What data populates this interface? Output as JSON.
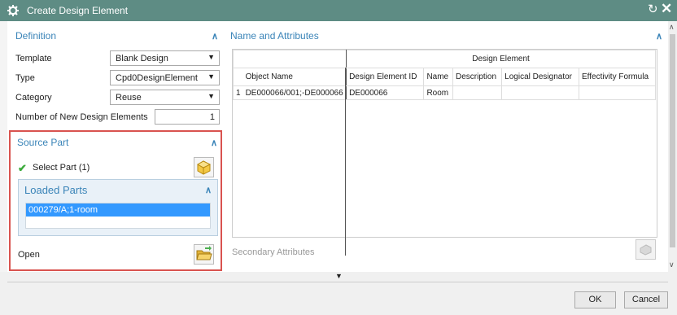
{
  "window": {
    "title": "Create Design Element",
    "reset_icon": "reset-icon",
    "close_icon": "close-icon",
    "gear_icon": "gear-icon"
  },
  "definition": {
    "header": "Definition",
    "fields": [
      {
        "label": "Template",
        "value": "Blank Design"
      },
      {
        "label": "Type",
        "value": "Cpd0DesignElement"
      },
      {
        "label": "Category",
        "value": "Reuse"
      }
    ],
    "number_label": "Number of New Design Elements",
    "number_value": "1"
  },
  "source_part": {
    "header": "Source Part",
    "select_label": "Select Part (1)",
    "loaded_parts": {
      "header": "Loaded Parts",
      "items": [
        "000279/A;1-room"
      ]
    },
    "open_label": "Open"
  },
  "name_attributes": {
    "header": "Name and Attributes",
    "group_header": "Design Element",
    "columns": [
      "Object Name",
      "Design Element ID",
      "Name",
      "Description",
      "Logical Designator",
      "Effectivity Formula"
    ],
    "rows": [
      {
        "index": "1",
        "object_name": "DE000066/001;-DE000066",
        "design_element_id": "DE000066",
        "name": "Room",
        "description": "",
        "logical_designator": "",
        "effectivity_formula": ""
      }
    ],
    "secondary_label": "Secondary Attributes"
  },
  "footer": {
    "ok": "OK",
    "cancel": "Cancel"
  },
  "colors": {
    "titlebar": "#5e8c84",
    "accent": "#3a84b8",
    "highlight": "#d9534f",
    "selection": "#3399ff"
  }
}
